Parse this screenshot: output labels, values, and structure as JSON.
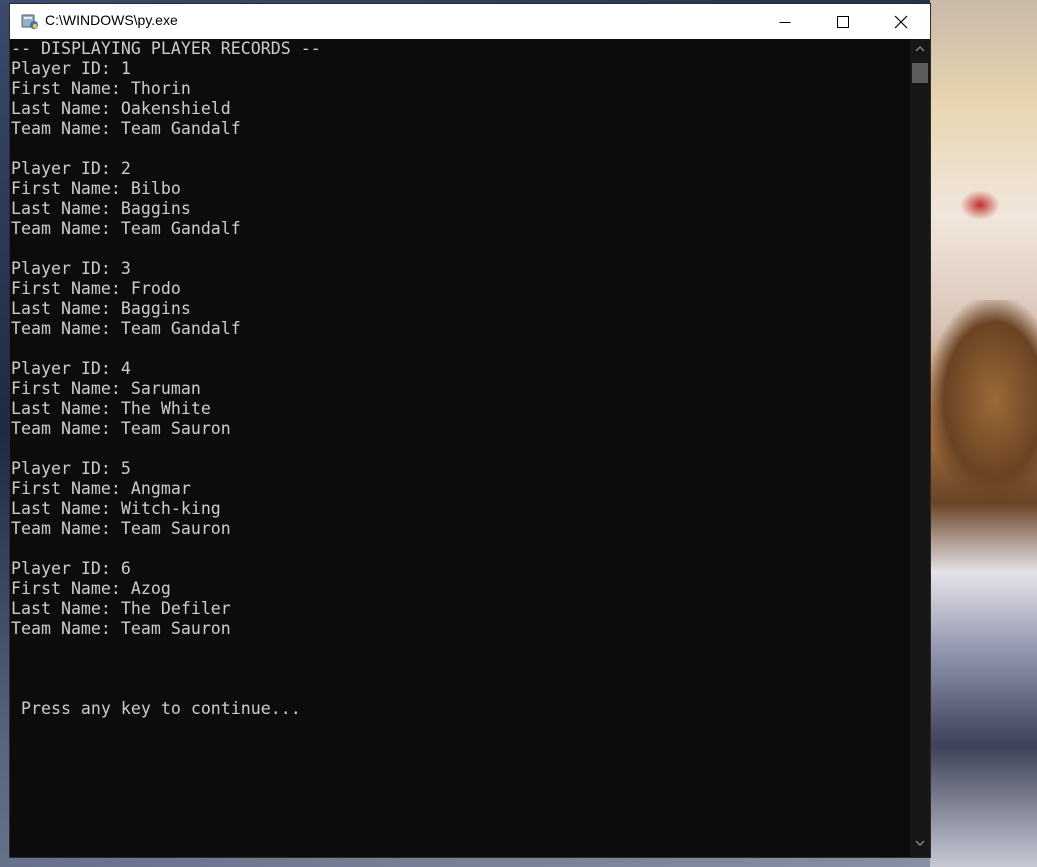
{
  "window": {
    "title": "C:\\WINDOWS\\py.exe",
    "controls": [
      "minimize",
      "maximize",
      "close"
    ]
  },
  "console": {
    "lines": [
      "-- DISPLAYING PLAYER RECORDS --",
      "Player ID: 1",
      "First Name: Thorin",
      "Last Name: Oakenshield",
      "Team Name: Team Gandalf",
      "",
      "Player ID: 2",
      "First Name: Bilbo",
      "Last Name: Baggins",
      "Team Name: Team Gandalf",
      "",
      "Player ID: 3",
      "First Name: Frodo",
      "Last Name: Baggins",
      "Team Name: Team Gandalf",
      "",
      "Player ID: 4",
      "First Name: Saruman",
      "Last Name: The White",
      "Team Name: Team Sauron",
      "",
      "Player ID: 5",
      "First Name: Angmar",
      "Last Name: Witch-king",
      "Team Name: Team Sauron",
      "",
      "Player ID: 6",
      "First Name: Azog",
      "Last Name: The Defiler",
      "Team Name: Team Sauron",
      "",
      "",
      "",
      " Press any key to continue..."
    ]
  },
  "colors": {
    "console_bg": "#0c0c0c",
    "console_fg": "#cccccc",
    "titlebar_bg": "#ffffff",
    "scroll_thumb": "#5d5d5d"
  }
}
